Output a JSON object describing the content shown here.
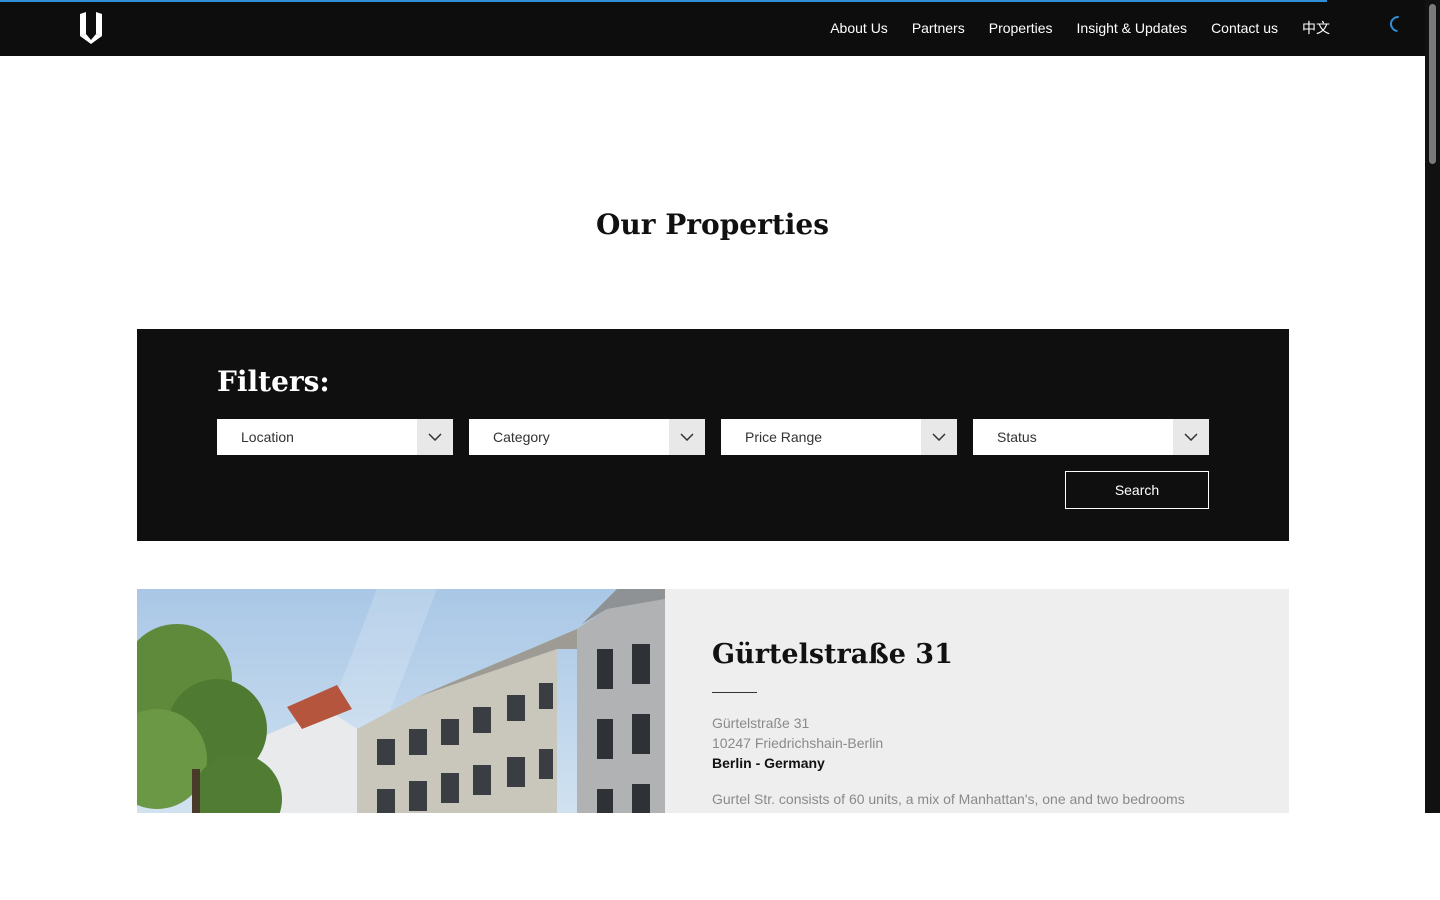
{
  "nav": {
    "links": [
      "About Us",
      "Partners",
      "Properties",
      "Insight & Updates",
      "Contact us",
      "中文"
    ]
  },
  "page": {
    "title": "Our Properties"
  },
  "filters": {
    "title": "Filters:",
    "selects": [
      "Location",
      "Category",
      "Price Range",
      "Status"
    ],
    "search_label": "Search"
  },
  "property": {
    "title": "Gürtelstraße 31",
    "address_line1": "Gürtelstraße 31",
    "address_line2": "10247 Friedrichshain-Berlin",
    "region": "Berlin - Germany",
    "description": "Gurtel Str. consists of 60 units, a mix of Manhattan's, one and two bedrooms apartments set in a vibrant neighbourhood"
  },
  "colors": {
    "accent": "#2f8fd6",
    "nav_bg": "#0d0d0d",
    "card_bg": "#eeeeee"
  }
}
